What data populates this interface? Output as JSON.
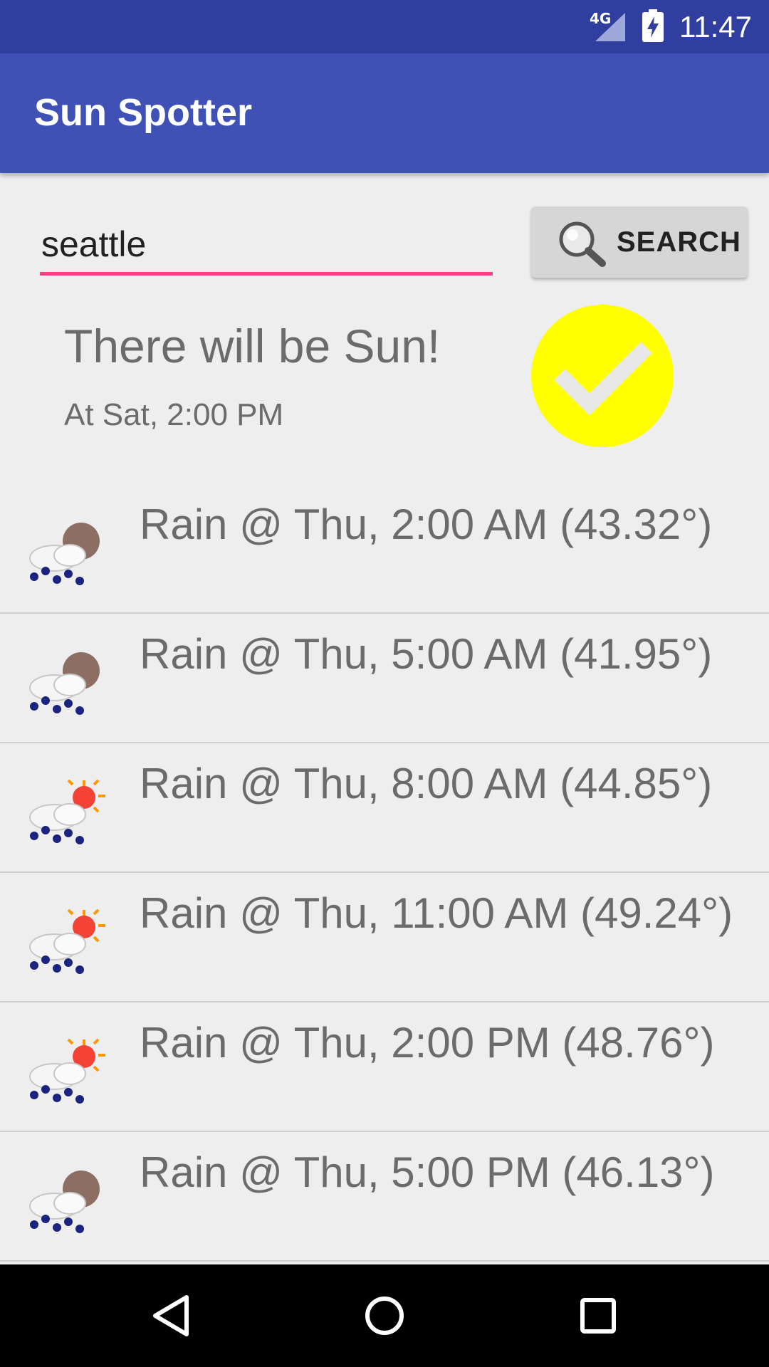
{
  "status_bar": {
    "network": "4G",
    "time": "11:47"
  },
  "app_bar": {
    "title": "Sun Spotter"
  },
  "search": {
    "value": "seattle",
    "button_label": "SEARCH"
  },
  "result": {
    "heading": "There will be Sun!",
    "time": "At Sat, 2:00 PM",
    "accent_color": "#ffff00"
  },
  "forecast": [
    {
      "text": "Rain @ Thu, 2:00 AM (43.32°)",
      "icon": "rain-night-icon"
    },
    {
      "text": "Rain @ Thu, 5:00 AM (41.95°)",
      "icon": "rain-night-icon"
    },
    {
      "text": "Rain @ Thu, 8:00 AM (44.85°)",
      "icon": "rain-day-icon"
    },
    {
      "text": "Rain @ Thu, 11:00 AM (49.24°)",
      "icon": "rain-day-icon"
    },
    {
      "text": "Rain @ Thu, 2:00 PM (48.76°)",
      "icon": "rain-day-icon"
    },
    {
      "text": "Rain @ Thu, 5:00 PM (46.13°)",
      "icon": "rain-night-icon"
    }
  ],
  "colors": {
    "status_bar": "#303f9f",
    "app_bar": "#3f51b5",
    "accent": "#ff4081"
  }
}
